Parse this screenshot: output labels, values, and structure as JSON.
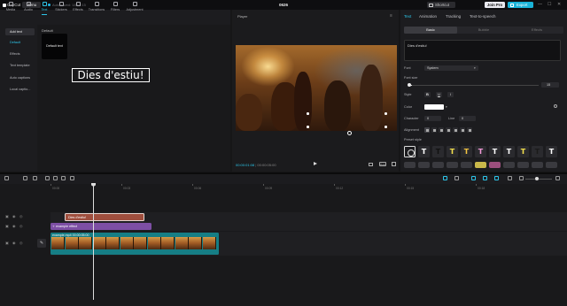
{
  "titlebar": {
    "app_name": "CapCut",
    "menu_label": "Menu",
    "autosave": "Auto saved: 18:13:15",
    "project_title": "0626",
    "shortcut_label": "Shortcut",
    "join_pro_label": "Join Pro",
    "export_label": "Export",
    "window_controls": [
      "—",
      "☐",
      "✕"
    ]
  },
  "toolbar": {
    "items": [
      {
        "label": "Media",
        "icon": "media-icon"
      },
      {
        "label": "Audio",
        "icon": "audio-icon"
      },
      {
        "label": "Text",
        "icon": "text-icon",
        "active": true
      },
      {
        "label": "Stickers",
        "icon": "sticker-icon"
      },
      {
        "label": "Effects",
        "icon": "effects-icon"
      },
      {
        "label": "Transitions",
        "icon": "transitions-icon"
      },
      {
        "label": "Filters",
        "icon": "filters-icon"
      },
      {
        "label": "Adjustment",
        "icon": "adjustment-icon"
      }
    ]
  },
  "leftnav": {
    "items": [
      "Add text",
      "Default",
      "Effects",
      "Text template",
      "Auto captions",
      "Local captio..."
    ],
    "selected": 0,
    "sub_selected": 1
  },
  "library": {
    "heading": "Default",
    "card_label": "Default text"
  },
  "player": {
    "title": "Player",
    "overlay_text": "Dies d'estiu!",
    "current_time": "00:00:01:08",
    "total_time": "00:00:05:00",
    "ratio_label": "Ratio"
  },
  "rightpanel": {
    "tabs": [
      "Text",
      "Animation",
      "Tracking",
      "Text-to-speech"
    ],
    "active_tab": 0,
    "segments": [
      "Basic",
      "Bubble",
      "Effects"
    ],
    "active_segment": 0,
    "text_value": "Dies d'estiu!",
    "font_label": "Font",
    "font_value": "System",
    "font_size_label": "Font size",
    "font_size_value": "15",
    "style_label": "Style",
    "style_buttons": [
      "B",
      "U",
      "I"
    ],
    "color_label": "Color",
    "color_value": "#ffffff",
    "character_label": "Character",
    "character_value": "0",
    "line_label": "Line",
    "line_value": "0",
    "alignment_label": "Alignment",
    "preset_label": "Preset style",
    "presets": [
      {
        "glyph": "",
        "fg": "#ffffff",
        "bg": "#1c1c1f"
      },
      {
        "glyph": "T",
        "fg": "#ffffff",
        "bg": "#2a2a2e"
      },
      {
        "glyph": "T",
        "fg": "#111111",
        "bg": "#2a2a2e"
      },
      {
        "glyph": "T",
        "fg": "#f4e04d",
        "bg": "#2a2a2e"
      },
      {
        "glyph": "T",
        "fg": "#f5c542",
        "bg": "#2a2a2e"
      },
      {
        "glyph": "T",
        "fg": "#f29ad8",
        "bg": "#2a2a2e"
      },
      {
        "glyph": "T",
        "fg": "#ffffff",
        "bg": "#2a2a2e"
      },
      {
        "glyph": "T",
        "fg": "#ffffff",
        "bg": "#2a2a2e"
      },
      {
        "glyph": "T",
        "fg": "#f4e04d",
        "bg": "#2a2a2e"
      },
      {
        "glyph": "T",
        "fg": "#1a1a1a",
        "bg": "#2a2a2e"
      },
      {
        "glyph": "T",
        "fg": "#ffffff",
        "bg": "#2a2a2e"
      }
    ],
    "chips": [
      "#3a3a3f",
      "#3a3a3f",
      "#3a3a3f",
      "#3a3a3f",
      "#3a3a3f",
      "#c9b84a",
      "#9b4f7d",
      "#3a3a3f",
      "#3a3a3f",
      "#3a3a3f",
      "#3a3a3f"
    ]
  },
  "timeline": {
    "ruler": [
      "00:00",
      "00:03",
      "00:06",
      "00:09",
      "00:12",
      "00:15",
      "00:18"
    ],
    "text_clip": "Dies d'estiu!",
    "effect_clip": "example effect",
    "video_clip": "example.mp4  00:00:05:00",
    "cover_label": "Cover"
  },
  "colors": {
    "accent": "#2dc5e8",
    "text_clip": "#9f4e3d",
    "effect_clip": "#7d4fa4",
    "video_clip": "#167e85"
  }
}
